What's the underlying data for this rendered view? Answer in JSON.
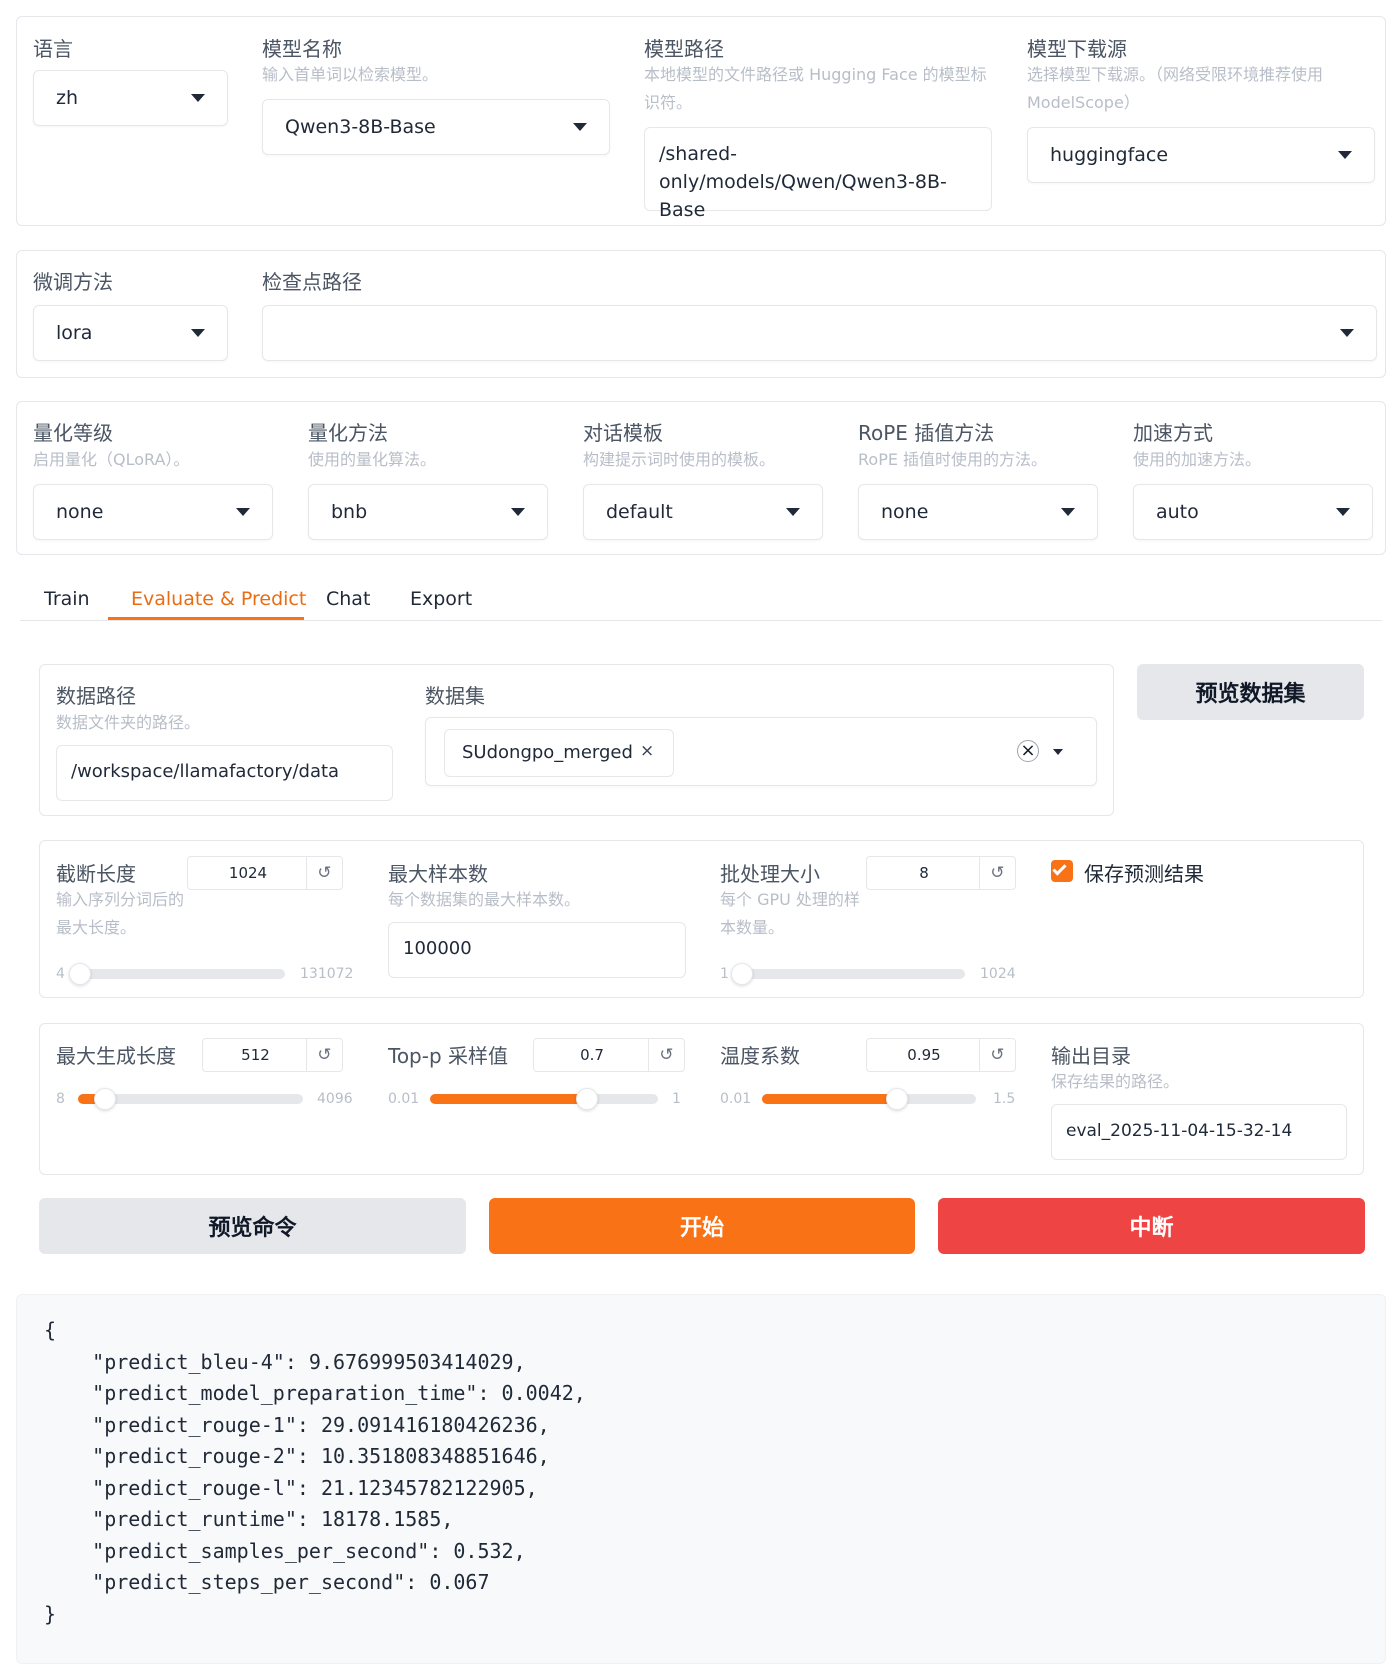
{
  "top": {
    "lang": {
      "label": "语言",
      "value": "zh"
    },
    "model_name": {
      "label": "模型名称",
      "info": "输入首单词以检索模型。",
      "value": "Qwen3-8B-Base"
    },
    "model_path": {
      "label": "模型路径",
      "info": "本地模型的文件路径或 Hugging Face 的模型标识符。",
      "value": "/shared-only/models/Qwen/Qwen3-8B-Base"
    },
    "hub": {
      "label": "模型下载源",
      "info": "选择模型下载源。（网络受限环境推荐使用 ModelScope）",
      "value": "huggingface"
    }
  },
  "finetune": {
    "method": {
      "label": "微调方法",
      "value": "lora"
    },
    "checkpoint": {
      "label": "检查点路径",
      "value": ""
    }
  },
  "advanced": {
    "quant_bit": {
      "label": "量化等级",
      "info": "启用量化（QLoRA）。",
      "value": "none"
    },
    "quant_method": {
      "label": "量化方法",
      "info": "使用的量化算法。",
      "value": "bnb"
    },
    "template": {
      "label": "对话模板",
      "info": "构建提示词时使用的模板。",
      "value": "default"
    },
    "rope": {
      "label": "RoPE 插值方法",
      "info": "RoPE 插值时使用的方法。",
      "value": "none"
    },
    "booster": {
      "label": "加速方式",
      "info": "使用的加速方法。",
      "value": "auto"
    }
  },
  "tabs": [
    "Train",
    "Evaluate & Predict",
    "Chat",
    "Export"
  ],
  "active_tab": 1,
  "dataset": {
    "dir_label": "数据路径",
    "dir_info": "数据文件夹的路径。",
    "dir_value": "/workspace/llamafactory/data",
    "label": "数据集",
    "chip": "SUdongpo_merged",
    "preview_button": "预览数据集"
  },
  "params1": {
    "cutoff": {
      "label": "截断长度",
      "info": "输入序列分词后的最大长度。",
      "value": "1024",
      "min": "4",
      "max": "131072",
      "frac": 0.01
    },
    "max_samples": {
      "label": "最大样本数",
      "info": "每个数据集的最大样本数。",
      "value": "100000"
    },
    "batch": {
      "label": "批处理大小",
      "info": "每个 GPU 处理的样本数量。",
      "value": "8",
      "min": "1",
      "max": "1024",
      "frac": 0.01
    },
    "predict": {
      "label": "保存预测结果",
      "checked": true
    }
  },
  "params2": {
    "max_new": {
      "label": "最大生成长度",
      "value": "512",
      "min": "8",
      "max": "4096",
      "frac": 0.12
    },
    "top_p": {
      "label": "Top-p 采样值",
      "value": "0.7",
      "min": "0.01",
      "max": "1",
      "frac": 0.69
    },
    "temp": {
      "label": "温度系数",
      "value": "0.95",
      "min": "0.01",
      "max": "1.5",
      "frac": 0.63
    },
    "output": {
      "label": "输出目录",
      "info": "保存结果的路径。",
      "value": "eval_2025-11-04-15-32-14"
    }
  },
  "actions": {
    "preview": "预览命令",
    "start": "开始",
    "stop": "中断"
  },
  "output_text": "{\n    \"predict_bleu-4\": 9.676999503414029,\n    \"predict_model_preparation_time\": 0.0042,\n    \"predict_rouge-1\": 29.091416180426236,\n    \"predict_rouge-2\": 10.351808348851646,\n    \"predict_rouge-l\": 21.12345782122905,\n    \"predict_runtime\": 18178.1585,\n    \"predict_samples_per_second\": 0.532,\n    \"predict_steps_per_second\": 0.067\n}",
  "colors": {
    "accent": "#f97316",
    "danger": "#ef4444",
    "secondary": "#e5e7eb"
  }
}
